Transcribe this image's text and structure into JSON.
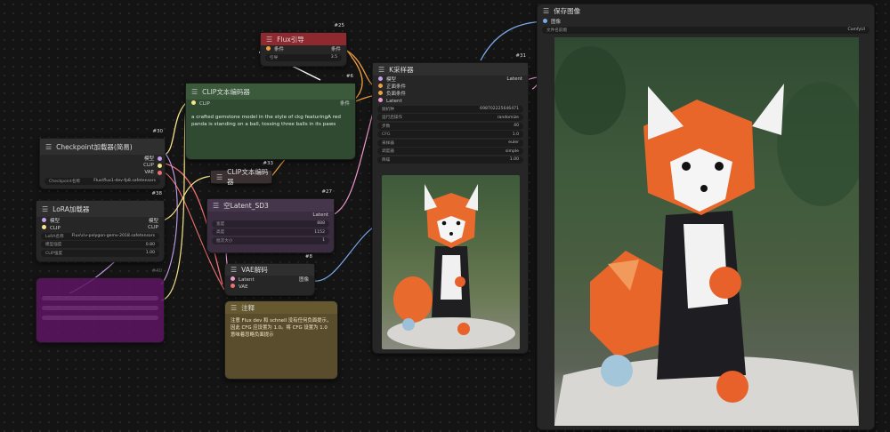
{
  "colors": {
    "guidance_title": "#8e2930",
    "clip_node": "#2f4a30",
    "latent_node": "#3a2d3f",
    "note_node": "#5a4d2d",
    "lora_node": "#5d1563"
  },
  "checkpoint": {
    "id": "#30",
    "title": "Checkpoint加载器(简易)",
    "out_model": "模型",
    "out_clip": "CLIP",
    "out_vae": "VAE",
    "field_label": "Checkpoint名称",
    "field_value": "Flux\\flux1-dev-fp8.safetensors"
  },
  "lora": {
    "id": "#38",
    "title": "LoRA加载器",
    "in_model": "模型",
    "in_clip": "CLIP",
    "out_model": "模型",
    "out_clip": "CLIP",
    "fields": [
      {
        "label": "LoRA名称",
        "value": "Flux\\civ-polygon-gemv-2018.safetensors"
      },
      {
        "label": "模型强度",
        "value": "0.80"
      },
      {
        "label": "CLIP强度",
        "value": "1.00"
      }
    ]
  },
  "clip_pos": {
    "id": "#6",
    "title": "CLIP文本编码器",
    "in": "CLIP",
    "out": "条件",
    "text": "a crafted gemstone model in the style of ckg featuringA red panda is standing on a ball, tossing three balls in its paws"
  },
  "clip_neg": {
    "id": "#33",
    "title": "CLIP文本编码器"
  },
  "guidance": {
    "id": "#25",
    "title": "Flux引导",
    "in": "条件",
    "out": "条件",
    "field_label": "引导",
    "field_value": "3.5"
  },
  "latent": {
    "id": "#27",
    "title": "空Latent_SD3",
    "out": "Latent",
    "fields": [
      {
        "label": "宽度",
        "value": "888"
      },
      {
        "label": "高度",
        "value": "1152"
      },
      {
        "label": "批次大小",
        "value": "1"
      }
    ]
  },
  "vae_decode": {
    "id": "#8",
    "title": "VAE解码",
    "in_latent": "Latent",
    "in_vae": "VAE",
    "out": "图像"
  },
  "note": {
    "title": "注释",
    "text": "注意 Flux dev 和 schnell 没有任何负面提示，因此 CFG 应设置为 1.0。将 CFG 设置为 1.0 意味着忽略负面提示"
  },
  "ksampler": {
    "id": "#31",
    "title": "K采样器",
    "in_model": "模型",
    "in_pos": "正面条件",
    "in_neg": "负面条件",
    "in_latent": "Latent",
    "out": "Latent",
    "fields": [
      {
        "label": "随机种",
        "value": "698702225646471"
      },
      {
        "label": "运行后操作",
        "value": "randomize"
      },
      {
        "label": "步数",
        "value": "40"
      },
      {
        "label": "CFG",
        "value": "1.0"
      },
      {
        "label": "采样器",
        "value": "euler"
      },
      {
        "label": "调度器",
        "value": "simple"
      },
      {
        "label": "降噪",
        "value": "1.00"
      }
    ]
  },
  "save": {
    "title": "保存图像",
    "in": "图像",
    "field_label": "文件名前缀",
    "field_value": "ComfyUI"
  },
  "bypassed": {
    "id": "#40"
  }
}
